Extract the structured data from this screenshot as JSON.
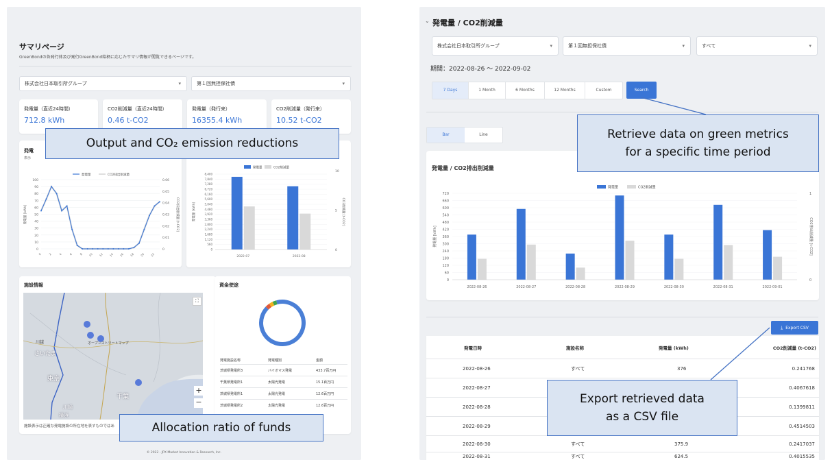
{
  "left": {
    "title": "サマリページ",
    "description": "GreenBondの各発行体及び発行GreenBond銘柄に応じたサマリ情報が閲覧できるページです。",
    "issuer_select": "株式会社日本取引所グループ",
    "bond_select": "第１回無担保社債",
    "metrics": [
      {
        "label": "発電量（直近24時間）",
        "value": "712.8 kWh"
      },
      {
        "label": "CO2削減量（直近24時間）",
        "value": "0.46 t-CO2"
      },
      {
        "label": "発電量（発行来）",
        "value": "16355.4 kWh"
      },
      {
        "label": "CO2削減量（発行来）",
        "value": "10.52 t-CO2"
      }
    ],
    "output_card_title": "発電",
    "output_card_sub": "表示",
    "line_legend": [
      "発電量",
      "CO2排出削減量"
    ],
    "line_y_left": [
      "100",
      "90",
      "80",
      "70",
      "60",
      "50",
      "40",
      "30",
      "20",
      "10",
      "0"
    ],
    "line_y_right": [
      "0.06",
      "0.05",
      "0.04",
      "0.03",
      "0.02",
      "0.01",
      "0"
    ],
    "line_ylabel_left": "発電量 [kWh]",
    "line_ylabel_right": "CO2排出削減量 [t-CO2]",
    "bar_legend": [
      "発電量",
      "CO2削減量"
    ],
    "bar_y_left": [
      "8,400",
      "7,840",
      "7,280",
      "6,720",
      "6,160",
      "5,600",
      "5,040",
      "4,480",
      "3,920",
      "3,360",
      "2,800",
      "2,240",
      "1,680",
      "1,120",
      "560",
      "0"
    ],
    "bar_y_right": [
      "10",
      "5",
      "0"
    ],
    "bar_ylabel_left": "発電量 [kWh]",
    "bar_ylabel_right": "CO2削減量 [t-CO2]",
    "bar_categories": [
      "2022-07",
      "2022-08"
    ],
    "facility_title": "施設情報",
    "map_labels": [
      "さいたま",
      "東京",
      "千葉",
      "川越",
      "川崎",
      "横浜"
    ],
    "map_credit": "オープンストリートマップ",
    "map_note": "施設表示は正確な発電施設の所在地を表すものではあ",
    "funds_title": "資金使途",
    "funds_headers": [
      "発電施設名称",
      "発電種別",
      "金額"
    ],
    "funds_rows": [
      [
        "茨城県発電所3",
        "バイオマス発電",
        "433.7百万円"
      ],
      [
        "千葉県発電所1",
        "太陽光発電",
        "15.1百万円"
      ],
      [
        "茨城県発電所1",
        "太陽光発電",
        "12.6百万円"
      ],
      [
        "茨城県発電所2",
        "太陽光発電",
        "12.6百万円"
      ]
    ],
    "footer": "© 2022 - JPX Market Innovation & Research, Inc."
  },
  "right": {
    "section_title": "発電量 / CO2削減量",
    "issuer_select": "株式会社日本取引所グループ",
    "bond_select": "第１回無担保社債",
    "facility_select": "すべて",
    "period_label": "期間：2022-08-26 ～ 2022-09-02",
    "range_buttons": [
      "7 Days",
      "1 Month",
      "6 Months",
      "12 Months",
      "Custom"
    ],
    "search_label": "Search",
    "chart_type_buttons": [
      "Bar",
      "Line"
    ],
    "chart_title": "発電量 / CO2排出削減量",
    "legend": [
      "発電量",
      "CO2削減量"
    ],
    "y_left": [
      "720",
      "660",
      "600",
      "540",
      "480",
      "420",
      "360",
      "300",
      "240",
      "180",
      "120",
      "60",
      "0"
    ],
    "y_right": [
      "1",
      "0"
    ],
    "ylabel_left": "発電量 [kWh]",
    "ylabel_right": "CO2排出削減量 [t-CO2]",
    "export_label": "Export CSV",
    "table_headers": [
      "発電日時",
      "施設名称",
      "発電量 (kWh)",
      "CO2削減量 (t-CO2)"
    ],
    "table_rows": [
      [
        "2022-08-26",
        "すべて",
        "376",
        "0.241768"
      ],
      [
        "2022-08-27",
        "",
        "",
        "0.4067618"
      ],
      [
        "2022-08-28",
        "",
        "",
        "0.1399811"
      ],
      [
        "2022-08-29",
        "",
        "",
        "0.4514503"
      ],
      [
        "2022-08-30",
        "すべて",
        "375.9",
        "0.2417037"
      ],
      [
        "2022-08-31",
        "すべて",
        "624.5",
        "0.4015535"
      ]
    ]
  },
  "callouts": {
    "output": "Output and CO₂ emission reductions",
    "retrieve_line1": "Retrieve data on green metrics",
    "retrieve_line2": "for a specific time period",
    "export_line1": "Export retrieved data",
    "export_line2": "as a CSV file",
    "allocation": "Allocation ratio of funds"
  },
  "chart_data": [
    {
      "type": "line",
      "title": "",
      "x": [
        "0",
        "1",
        "2",
        "3",
        "4",
        "5",
        "6",
        "7",
        "8",
        "9",
        "10",
        "11",
        "12",
        "13",
        "14",
        "15",
        "16",
        "17",
        "18",
        "19",
        "20",
        "21",
        "22",
        "23"
      ],
      "series": [
        {
          "name": "発電量",
          "values": [
            55,
            72,
            90,
            80,
            55,
            62,
            28,
            5,
            0,
            0,
            0,
            0,
            0,
            0,
            0,
            0,
            0,
            0,
            2,
            8,
            28,
            48,
            62,
            68
          ]
        },
        {
          "name": "CO2排出削減量",
          "values": [
            0.033,
            0.043,
            0.054,
            0.048,
            0.033,
            0.037,
            0.017,
            0.003,
            0,
            0,
            0,
            0,
            0,
            0,
            0,
            0,
            0,
            0,
            0.001,
            0.005,
            0.017,
            0.029,
            0.037,
            0.041
          ]
        }
      ],
      "ylim": [
        0,
        100
      ]
    },
    {
      "type": "bar",
      "title": "",
      "categories": [
        "2022-07",
        "2022-08"
      ],
      "series": [
        {
          "name": "発電量",
          "values": [
            8100,
            7050
          ]
        },
        {
          "name": "CO2削減量",
          "values": [
            4.8,
            4.0
          ]
        }
      ],
      "ylim": [
        0,
        8400
      ]
    },
    {
      "type": "bar",
      "title": "発電量 / CO2排出削減量",
      "categories": [
        "2022-08-26",
        "2022-08-27",
        "2022-08-28",
        "2022-08-29",
        "2022-08-30",
        "2022-08-31",
        "2022-09-01"
      ],
      "series": [
        {
          "name": "発電量",
          "values": [
            376,
            590,
            218,
            702,
            376,
            624,
            413
          ]
        },
        {
          "name": "CO2削減量",
          "values": [
            0.241768,
            0.4067618,
            0.1399811,
            0.4514503,
            0.2417037,
            0.4015535,
            0.2654
          ]
        }
      ],
      "ylim": [
        0,
        720
      ]
    },
    {
      "type": "pie",
      "title": "資金使途",
      "categories": [
        "茨城県発電所3",
        "千葉県発電所1",
        "茨城県発電所1",
        "茨城県発電所2"
      ],
      "values": [
        433.7,
        15.1,
        12.6,
        12.6
      ],
      "colors": [
        "#4a7fd6",
        "#e05a3a",
        "#f2b01e",
        "#3fa34d"
      ]
    }
  ],
  "colors": {
    "primary": "#3a75d6",
    "secondary": "#d9d9d9",
    "callout_fill": "#dae4f2",
    "callout_border": "#4472c4"
  }
}
